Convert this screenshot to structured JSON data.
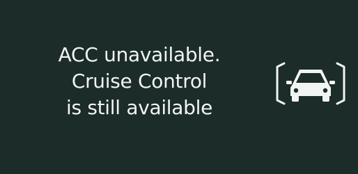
{
  "alert": {
    "lines": [
      "ACC unavailable.",
      "Cruise Control",
      "is still available"
    ]
  },
  "icon": {
    "name": "car-front-radar-icon"
  },
  "colors": {
    "background": "#1b2c29",
    "text": "#f2f4f3",
    "icon": "#f2f4f3"
  }
}
